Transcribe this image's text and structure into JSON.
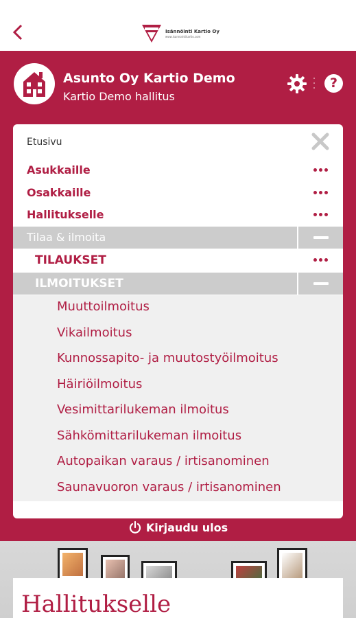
{
  "header": {
    "back_icon": "chevron-left-icon",
    "logo_name": "Isännöinti Kartio Oy",
    "logo_url": "www.isannointikartio.com"
  },
  "association": {
    "title": "Asunto Oy Kartio Demo",
    "subtitle": "Kartio Demo hallitus",
    "icon": "house-icon"
  },
  "actions": {
    "settings_icon": "gear-icon",
    "help_label": "?"
  },
  "menu": {
    "home": "Etusivu",
    "close_icon": "close-icon",
    "items": [
      {
        "label": "Asukkaille"
      },
      {
        "label": "Osakkaille"
      },
      {
        "label": "Hallitukselle"
      }
    ],
    "section": {
      "label": "Tilaa & ilmoita"
    },
    "orders": {
      "label": "TILAUKSET"
    },
    "notices": {
      "label": "ILMOITUKSET",
      "items": [
        "Muuttoilmoitus",
        "Vikailmoitus",
        "Kunnossapito- ja muutostyöilmoitus",
        "Häiriöilmoitus",
        "Vesimittarilukeman ilmoitus",
        "Sähkömittarilukeman ilmoitus",
        "Autopaikan varaus / irtisanominen",
        "Saunavuoron varaus / irtisanominen"
      ]
    }
  },
  "logout": {
    "label": "Kirjaudu ulos"
  },
  "content": {
    "title": "Hallitukselle"
  },
  "colors": {
    "brand": "#b01e44",
    "grey": "#cccccc",
    "panel": "#f0f0f0"
  }
}
